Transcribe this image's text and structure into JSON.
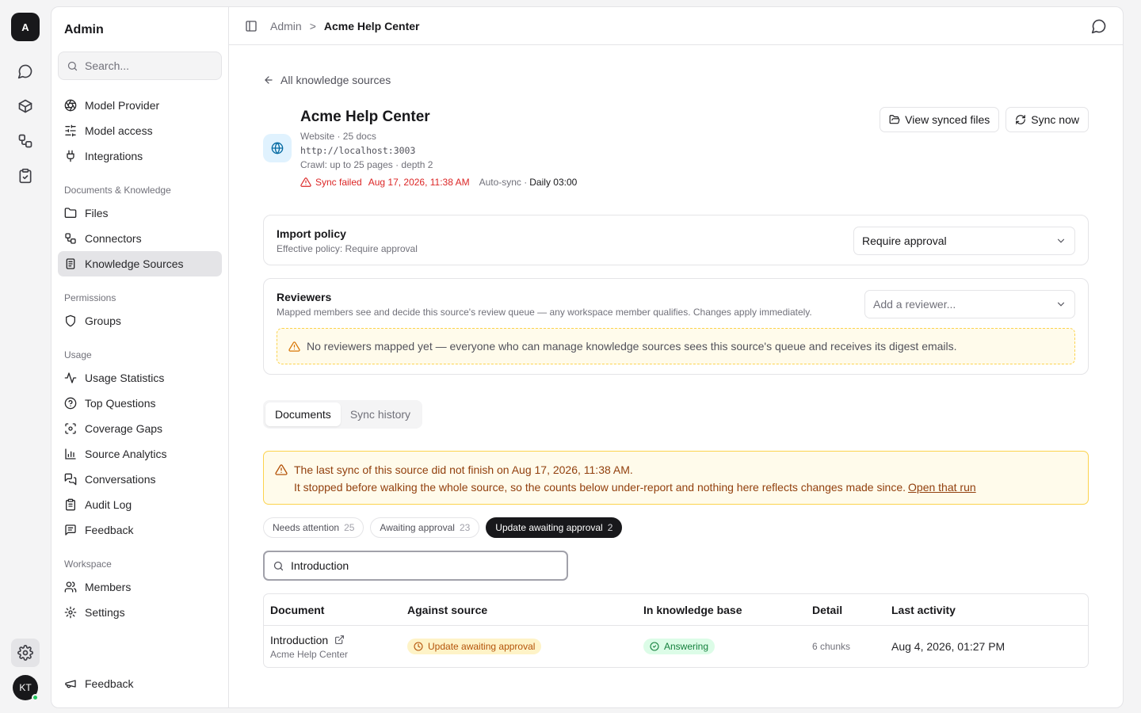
{
  "rail": {
    "logo_letter": "A",
    "avatar_initials": "KT"
  },
  "sidebar": {
    "title": "Admin",
    "search_placeholder": "Search...",
    "top_items": [
      "Model Provider",
      "Model access",
      "Integrations"
    ],
    "groups": [
      {
        "label": "Documents & Knowledge",
        "items": [
          "Files",
          "Connectors",
          "Knowledge Sources"
        ]
      },
      {
        "label": "Permissions",
        "items": [
          "Groups"
        ]
      },
      {
        "label": "Usage",
        "items": [
          "Usage Statistics",
          "Top Questions",
          "Coverage Gaps",
          "Source Analytics",
          "Conversations",
          "Audit Log",
          "Feedback"
        ]
      },
      {
        "label": "Workspace",
        "items": [
          "Members",
          "Settings"
        ]
      }
    ],
    "footer_item": "Feedback"
  },
  "breadcrumb": {
    "parent": "Admin",
    "separator": ">",
    "current": "Acme Help Center"
  },
  "back_link": "All knowledge sources",
  "source": {
    "name": "Acme Help Center",
    "meta": "Website · 25 docs",
    "url": "http://localhost:3003",
    "crawl": "Crawl: up to 25 pages · depth 2",
    "status_label": "Sync failed",
    "status_date": "Aug 17, 2026, 11:38 AM",
    "autosync_label": "Auto-sync ·",
    "autosync_schedule": "Daily 03:00"
  },
  "actions": {
    "view_files": "View synced files",
    "sync_now": "Sync now"
  },
  "import_policy": {
    "title": "Import policy",
    "subtitle": "Effective policy: Require approval",
    "selected": "Require approval"
  },
  "reviewers": {
    "title": "Reviewers",
    "subtitle": "Mapped members see and decide this source's review queue — any workspace member qualifies. Changes apply immediately.",
    "add_placeholder": "Add a reviewer...",
    "empty_notice": "No reviewers mapped yet — everyone who can manage knowledge sources sees this source's queue and receives its digest emails."
  },
  "tabs": [
    "Documents",
    "Sync history"
  ],
  "alert": {
    "line1": "The last sync of this source did not finish on Aug 17, 2026, 11:38 AM.",
    "line2": "It stopped before walking the whole source, so the counts below under-report and nothing here reflects changes made since.",
    "link": "Open that run"
  },
  "filters": [
    {
      "label": "Needs attention",
      "count": "25"
    },
    {
      "label": "Awaiting approval",
      "count": "23"
    },
    {
      "label": "Update awaiting approval",
      "count": "2"
    }
  ],
  "search_value": "Introduction",
  "table": {
    "headers": [
      "Document",
      "Against source",
      "In knowledge base",
      "Detail",
      "Last activity"
    ],
    "rows": [
      {
        "document": "Introduction",
        "source": "Acme Help Center",
        "against_source": "Update awaiting approval",
        "in_kb": "Answering",
        "detail": "6 chunks",
        "last_activity": "Aug 4, 2026, 01:27 PM"
      }
    ]
  },
  "colors": {
    "accent_dark": "#18181b",
    "danger": "#dc2626",
    "warning_text": "#92400e",
    "warning_bg": "#fffbeb",
    "success": "#15803d"
  }
}
